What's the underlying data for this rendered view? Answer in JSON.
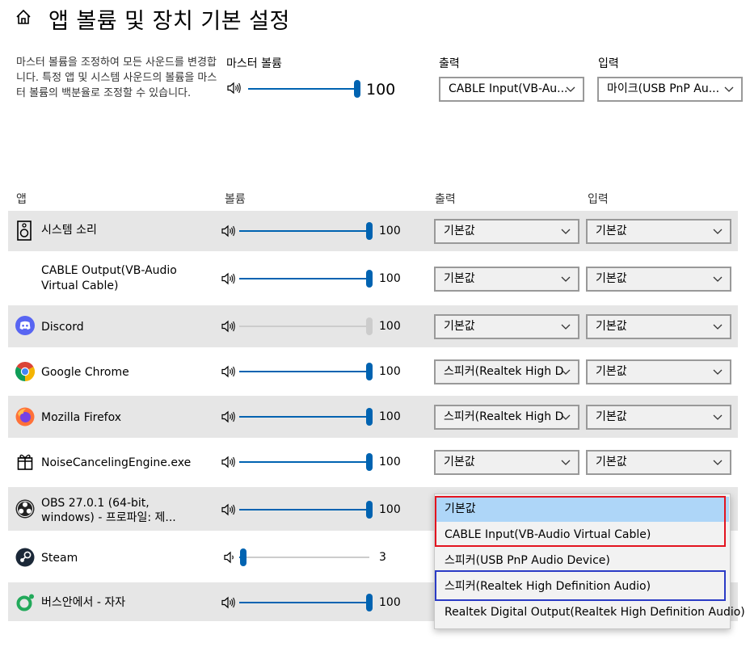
{
  "page": {
    "title": "앱 볼륨 및 장치 기본 설정",
    "description": "마스터 볼륨을 조정하여 모든 사운드를 변경합니다. 특정 앱 및 시스템 사운드의 볼륨을 마스터 볼륨의 백분율로 조정할 수 있습니다."
  },
  "master": {
    "label": "마스터 볼륨",
    "value": "100",
    "level": 100,
    "output_label": "출력",
    "output_value": "CABLE Input(VB-Au...",
    "input_label": "입력",
    "input_value": "마이크(USB PnP Au..."
  },
  "columns": {
    "app": "앱",
    "volume": "볼륨",
    "output": "출력",
    "input": "입력"
  },
  "apps": [
    {
      "name_line1": "시스템 소리",
      "name_line2": "",
      "icon": "speaker-box-icon",
      "volume": "100",
      "level": 100,
      "output": "기본값",
      "input": "기본값"
    },
    {
      "name_line1": "CABLE Output(VB-Audio",
      "name_line2": "Virtual Cable)",
      "icon": "",
      "volume": "100",
      "level": 100,
      "output": "기본값",
      "input": "기본값"
    },
    {
      "name_line1": "Discord",
      "name_line2": "",
      "icon": "discord-icon",
      "volume": "100",
      "level": 100,
      "output": "기본값",
      "input": "기본값"
    },
    {
      "name_line1": "Google Chrome",
      "name_line2": "",
      "icon": "chrome-icon",
      "volume": "100",
      "level": 100,
      "output": "스피커(Realtek High D",
      "input": "기본값"
    },
    {
      "name_line1": "Mozilla Firefox",
      "name_line2": "",
      "icon": "firefox-icon",
      "volume": "100",
      "level": 100,
      "output": "스피커(Realtek High D",
      "input": "기본값"
    },
    {
      "name_line1": "NoiseCancelingEngine.exe",
      "name_line2": "",
      "icon": "gift-icon",
      "volume": "100",
      "level": 100,
      "output": "기본값",
      "input": "기본값"
    },
    {
      "name_line1": "OBS 27.0.1 (64-bit,",
      "name_line2": "windows) - 프로파일: 제...",
      "icon": "obs-icon",
      "volume": "100",
      "level": 100,
      "output": "",
      "input": ""
    },
    {
      "name_line1": "Steam",
      "name_line2": "",
      "icon": "steam-icon",
      "volume": "3",
      "level": 3,
      "output": "",
      "input": ""
    },
    {
      "name_line1": "버스안에서 - 자자",
      "name_line2": "",
      "icon": "music-app-icon",
      "volume": "100",
      "level": 100,
      "output": "",
      "input": ""
    }
  ],
  "dropdown_menu": {
    "items": [
      "기본값",
      "CABLE Input(VB-Audio Virtual Cable)",
      "스피커(USB PnP Audio Device)",
      "스피커(Realtek High Definition Audio)",
      "Realtek Digital Output(Realtek High Definition Audio)"
    ],
    "selected_index": 0
  },
  "colors": {
    "accent": "#0063b1",
    "highlight": "#aed6f8",
    "red_annotation": "#e3141f",
    "blue_annotation": "#2a3bc6"
  }
}
